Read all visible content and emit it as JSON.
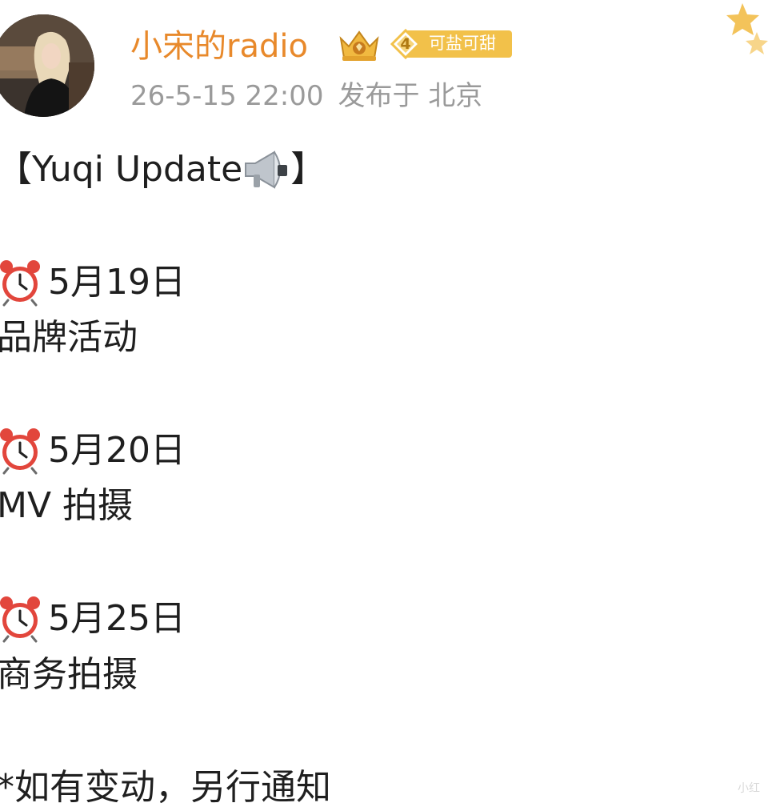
{
  "user": {
    "name": "小宋的radio",
    "level": "4",
    "badge_text": "可盐可甜",
    "timestamp": "26-5-15 22:00",
    "location": "发布于 北京"
  },
  "post": {
    "title_prefix": "【Yuqi Update",
    "title_suffix": "】",
    "schedule": [
      {
        "date": "5月19日",
        "event": "品牌活动"
      },
      {
        "date": "5月20日",
        "event": "MV 拍摄"
      },
      {
        "date": "5月25日",
        "event": "商务拍摄"
      }
    ],
    "note": "*如有变动，另行通知"
  },
  "watermark": "小红",
  "colors": {
    "username": "#e8892b",
    "badge": "#f2c14a",
    "meta": "#9a9a9a",
    "text": "#1f1f1f"
  },
  "icons": {
    "title": "megaphone-icon",
    "schedule": "alarm-clock-icon",
    "user_badge": "crown-icon",
    "corner": "star-icon"
  }
}
